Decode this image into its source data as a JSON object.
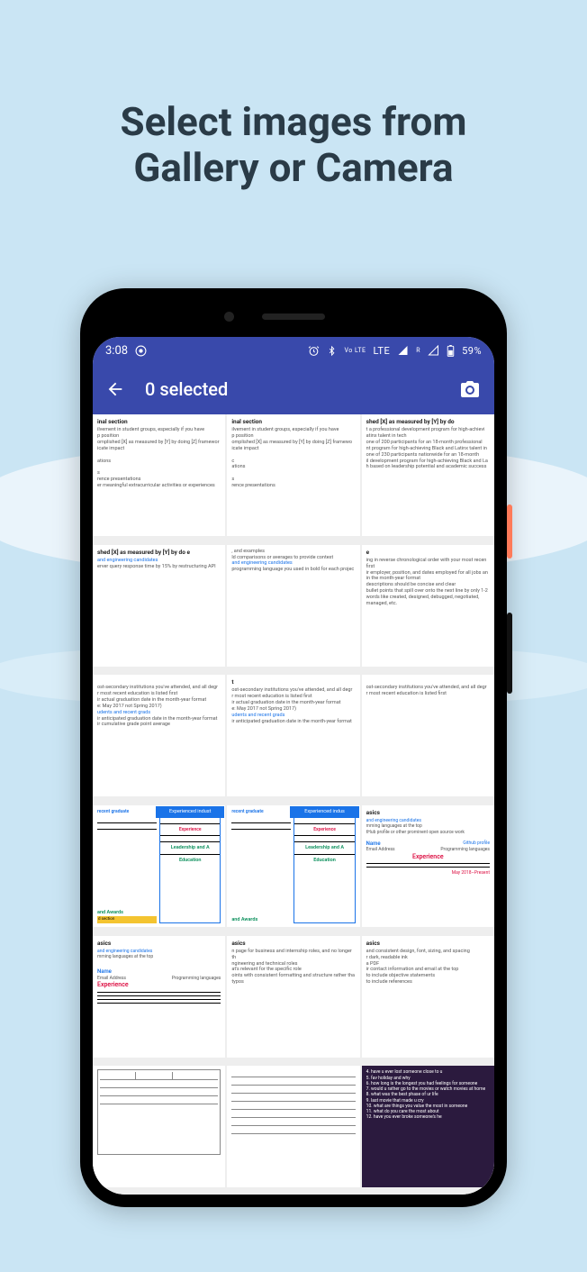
{
  "headline_line1": "Select images from",
  "headline_line2": "Gallery or Camera",
  "status": {
    "time": "3:08",
    "vo_lte": "Vo LTE",
    "lte": "LTE",
    "r": "R",
    "battery": "59%"
  },
  "appbar": {
    "title": "0 selected"
  },
  "thumbs": {
    "t1": {
      "h": "inal section",
      "l1": "ilvement in student groups, especially if you have",
      "l2": "p position",
      "l3": "omplished [X] as measured by [Y] by doing [Z] framewor",
      "l4": "icate impact",
      "l5": "ations",
      "l6": "s",
      "l7": "rence presentations",
      "l8": "er meaningful extracurricular activities or experiences"
    },
    "t2": {
      "h": "inal section",
      "l1": "ilvement in student groups, especially if you have",
      "l2": "p position",
      "l3": "omplished [X] as measured by [Y] by doing [Z] framewo",
      "l4": "icate impact",
      "l5": "c",
      "l6": "ations",
      "l7": "s",
      "l8": "rence presentations"
    },
    "t3": {
      "h": "shed [X] as measured by [Y] by do",
      "l1": "t a professional development program for high-achievi",
      "l2": "atinx talent in tech",
      "l3": "one of 200 participants for an 18-month professional",
      "l4": "nt program for high-achieving Black and Latinx talent in",
      "l5": "one of 230 participants nationwide for an 18-month",
      "l6": "il development program for high-achieving Black and La",
      "l7": "h based on leadership potential and academic success"
    },
    "t4": {
      "h": "shed [X] as measured by [Y] by do e",
      "link": "and engineering candidates",
      "l1": "erver query response time by 15% by restructuring API"
    },
    "t5": {
      "l1": ", and examples",
      "l2": "ld comparisons or averages to provide context",
      "link": "and engineering candidates",
      "l3": "programming language you used in bold for each projec"
    },
    "t6": {
      "h": "e",
      "l1": "ing in reverse chronological order with your most recen",
      "l2": "first",
      "l3": "ir employer, position, and dates employed for all jobs an",
      "l4": "in the month-year format",
      "l5": "descriptions should be concise and clear",
      "l6": "bullet points that spill over onto the next line by only 1-2",
      "l7": "words like created, designed, debugged, negotiated,",
      "l8": "managed, etc."
    },
    "t7": {
      "l1": "ost-secondary institutions you've attended, and all degr",
      "l2": "r most recent education is listed first",
      "l3": "ir actual graduation date in the month-year format",
      "l4": "e: May 2017 not Spring 2017)",
      "link": "udents and recent grads",
      "l5": "ir anticipated graduation date in the month-year format",
      "l6": "ir cumulative grade point average"
    },
    "t8": {
      "h": "t",
      "l1": "ost-secondary institutions you've attended, and all degr",
      "l2": "r most recent education is listed first",
      "l3": "ir actual graduation date in the month-year format",
      "l4": "e: May 2017 not Spring 2017)",
      "link": "udents and recent grads",
      "l5": "ir anticipated graduation date in the month-year format"
    },
    "t9": {
      "l1": "ost-secondary institutions you've attended, and all degr",
      "l2": "r most recent education is listed first"
    },
    "t10": {
      "left_h": "recent graduate",
      "right_bar": "Experienced indust",
      "exp": "Experience",
      "lead": "Leadership and A",
      "edu": "Education",
      "awards": "and Awards",
      "sec": "d section"
    },
    "t11": {
      "left_h": "recent graduate",
      "right_bar": "Experienced indus",
      "exp": "Experience",
      "lead": "Leadership and A",
      "edu": "Education",
      "awards": "and Awards"
    },
    "t12": {
      "h": "asics",
      "link": "and engineering candidates",
      "l1": "mming languages at the top",
      "l2": "tHub profile or other prominent open source work",
      "name": "Name",
      "email": "Email Address",
      "prog": "Programming languages",
      "exp": "Experience",
      "date": "May 2018–Present"
    },
    "t13": {
      "h": "asics",
      "link": "and engineering candidates",
      "l1": "mming languages at the top",
      "name": "Name",
      "email": "Email Address",
      "prog": "Programming languages",
      "exp": "Experience"
    },
    "t14": {
      "h": "asics",
      "l1": "n page for business and internship roles, and no longer th",
      "l2": "ngineering and technical roles",
      "l3": "at's relevant for the specific role",
      "l4": "oints with consistent formatting and structure rather tha",
      "l5": "typos"
    },
    "t15": {
      "h": "asics",
      "l1": "and consistent design, font, sizing, and spacing",
      "l2": "r dark, readable ink",
      "l3": "a PDF",
      "l4": "ir contact information and email at the top",
      "l5": "to include objective statements",
      "l6": "to include references"
    },
    "t16": {
      "note": "form table"
    },
    "t17": {
      "note": "lined form"
    },
    "t18": {
      "q4": "4.  have u ever lost someone close to u",
      "q5": "5.  fav holiday and why",
      "q6": "6.  how long is the longest you had feelings for someone",
      "q7": "7.  would u rather go to the movies or watch movies at home",
      "q8": "8.  what was the best phase of ur life",
      "q9": "9.  last movie that made u cry",
      "q10": "10. what are things you value the most in someone",
      "q11": "11. what do you care the most about",
      "q12": "12. have you ever broke someone's he"
    }
  }
}
